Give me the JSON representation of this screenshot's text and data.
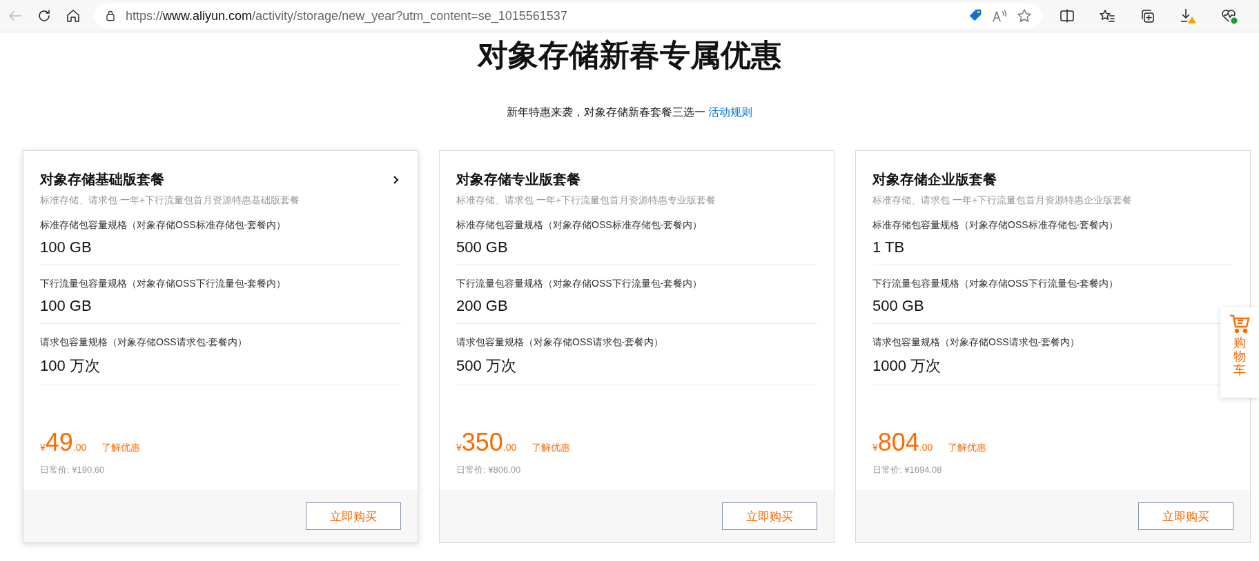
{
  "browser": {
    "url_prefix": "https://",
    "url_host": "www.aliyun.com",
    "url_path": "/activity/storage/new_year?utm_content=se_1015561537"
  },
  "page": {
    "title": "对象存储新春专属优惠",
    "subtitle": "新年特惠来袭，对象存储新春套餐三选一",
    "rules_link": "活动规则"
  },
  "cards": [
    {
      "title": "对象存储基础版套餐",
      "hovered": true,
      "description": "标准存储、请求包 一年+下行流量包首月资源特惠基础版套餐",
      "specs": [
        {
          "label": "标准存储包容量规格（对象存储OSS标准存储包-套餐内）",
          "value": "100 GB"
        },
        {
          "label": "下行流量包容量规格（对象存储OSS下行流量包-套餐内）",
          "value": "100 GB"
        },
        {
          "label": "请求包容量规格（对象存储OSS请求包-套餐内）",
          "value": "100 万次"
        }
      ],
      "currency": "¥",
      "price": "49",
      "price_cents": ".00",
      "discount_link": "了解优惠",
      "regular_price": "日常价: ¥190.60",
      "buy_button": "立即购买"
    },
    {
      "title": "对象存储专业版套餐",
      "hovered": false,
      "description": "标准存储、请求包 一年+下行流量包首月资源特惠专业版套餐",
      "specs": [
        {
          "label": "标准存储包容量规格（对象存储OSS标准存储包-套餐内）",
          "value": "500 GB"
        },
        {
          "label": "下行流量包容量规格（对象存储OSS下行流量包-套餐内）",
          "value": "200 GB"
        },
        {
          "label": "请求包容量规格（对象存储OSS请求包-套餐内）",
          "value": "500 万次"
        }
      ],
      "currency": "¥",
      "price": "350",
      "price_cents": ".00",
      "discount_link": "了解优惠",
      "regular_price": "日常价: ¥806.00",
      "buy_button": "立即购买"
    },
    {
      "title": "对象存储企业版套餐",
      "hovered": false,
      "description": "标准存储、请求包 一年+下行流量包首月资源特惠企业版套餐",
      "specs": [
        {
          "label": "标准存储包容量规格（对象存储OSS标准存储包-套餐内）",
          "value": "1 TB"
        },
        {
          "label": "下行流量包容量规格（对象存储OSS下行流量包-套餐内）",
          "value": "500 GB"
        },
        {
          "label": "请求包容量规格（对象存储OSS请求包-套餐内）",
          "value": "1000 万次"
        }
      ],
      "currency": "¥",
      "price": "804",
      "price_cents": ".00",
      "discount_link": "了解优惠",
      "regular_price": "日常价: ¥1694.08",
      "buy_button": "立即购买"
    }
  ],
  "cart_tab": {
    "label": "购物车"
  }
}
